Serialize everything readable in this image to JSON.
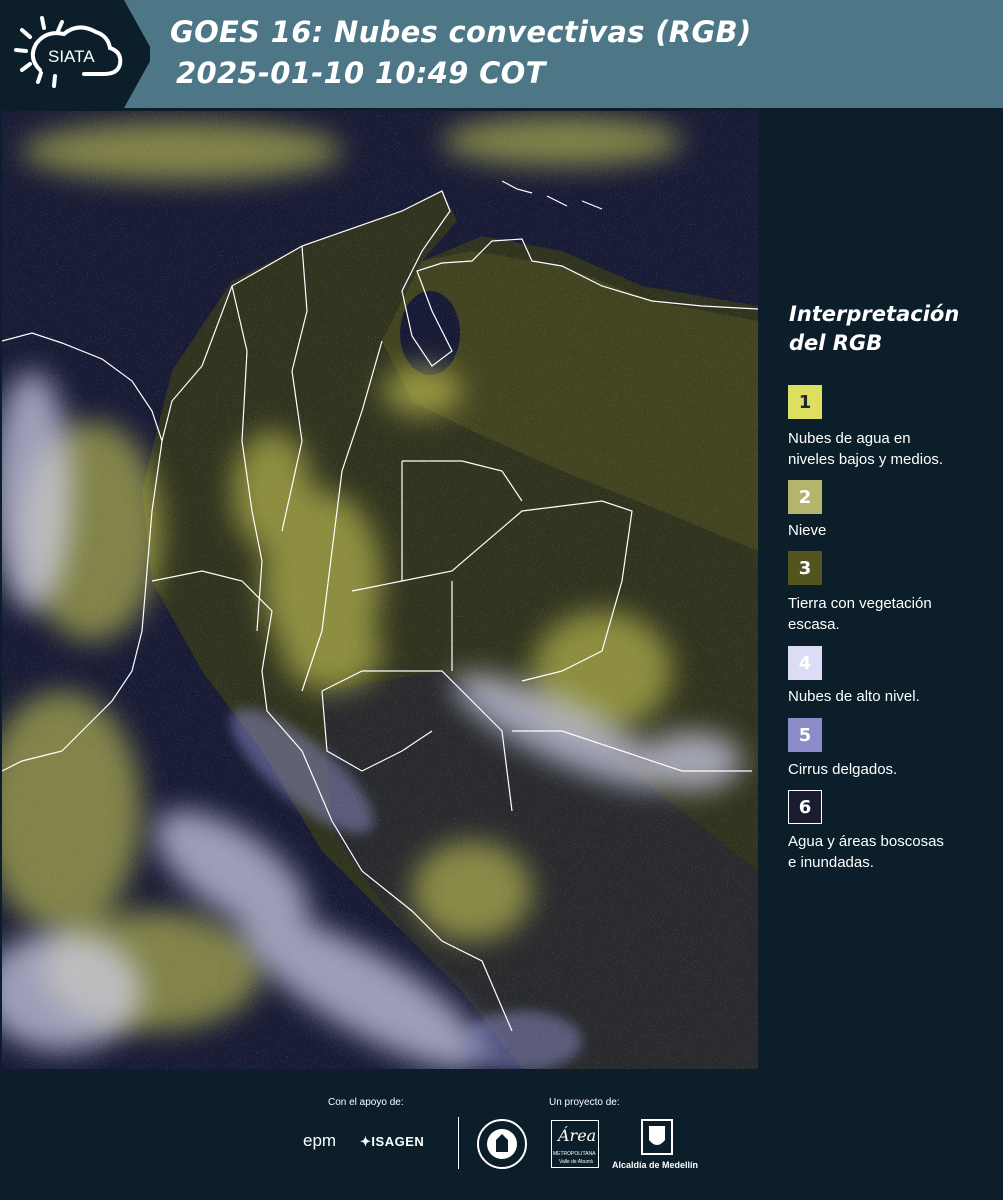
{
  "header": {
    "logo_text": "SIATA",
    "title_line1": "GOES 16: Nubes convectivas (RGB)",
    "title_line2": "2025-01-10 10:49 COT"
  },
  "legend": {
    "title_line1": "Interpretación",
    "title_line2": "del RGB",
    "items": [
      {
        "number": "1",
        "color": "#dede60",
        "text_color": "#1d2a33",
        "line1": "Nubes de agua en",
        "line2": "niveles bajos y medios."
      },
      {
        "number": "2",
        "color": "#b4b46c",
        "text_color": "#ffffff",
        "line1": "Nieve",
        "line2": ""
      },
      {
        "number": "3",
        "color": "#54541e",
        "text_color": "#ffffff",
        "line1": "Tierra con vegetación",
        "line2": "escasa."
      },
      {
        "number": "4",
        "color": "#dcdcf4",
        "text_color": "#ffffff",
        "line1": "Nubes de alto nivel.",
        "line2": ""
      },
      {
        "number": "5",
        "color": "#8c8cc8",
        "text_color": "#ffffff",
        "line1": "Cirrus delgados.",
        "line2": ""
      },
      {
        "number": "6",
        "color": "#1c1c30",
        "text_color": "#ffffff",
        "line1": "Agua y áreas boscosas",
        "line2": "e inundadas."
      }
    ]
  },
  "footer": {
    "support_label": "Con el apoyo de:",
    "project_label": "Un proyecto de:",
    "logo_epm": "epm",
    "logo_isagen": "ISAGEN",
    "logo_area_main": "Área",
    "logo_area_line1": "METROPOLITANA",
    "logo_area_line2": "Valle de Aburrá",
    "logo_alcaldia": "Alcaldía de Medellín"
  }
}
